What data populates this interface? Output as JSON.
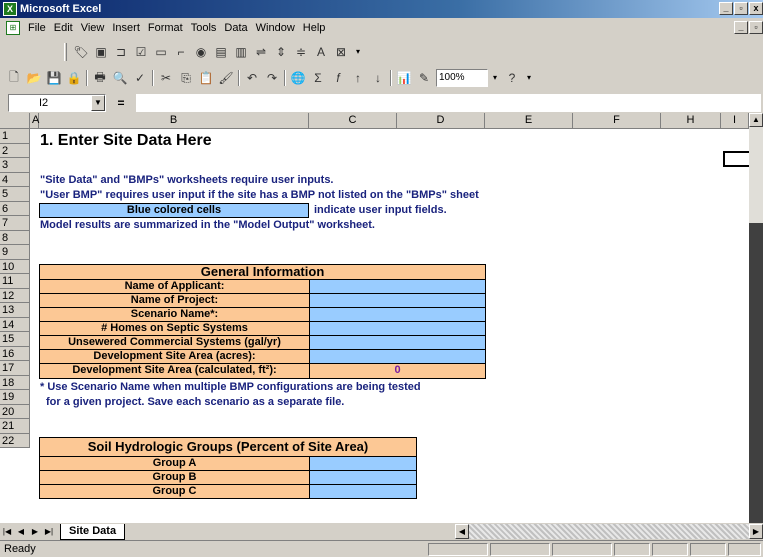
{
  "window": {
    "title": "Microsoft Excel",
    "app_icon": "excel-icon",
    "min_glyph": "_",
    "restore_glyph": "▫",
    "close_glyph": "x"
  },
  "menu": {
    "items": [
      "File",
      "Edit",
      "View",
      "Insert",
      "Format",
      "Tools",
      "Data",
      "Window",
      "Help"
    ],
    "doc_icon": "workbook-icon"
  },
  "toolbar": {
    "zoom": "100%"
  },
  "formula_bar": {
    "cell_ref": "I2",
    "equals": "=",
    "formula": ""
  },
  "columns": [
    "",
    "A",
    "B",
    "C",
    "D",
    "E",
    "F",
    "H",
    "I"
  ],
  "rows": [
    "1",
    "2",
    "3",
    "4",
    "5",
    "6",
    "7",
    "8",
    "9",
    "10",
    "11",
    "12",
    "13",
    "14",
    "15",
    "16",
    "17",
    "18",
    "19",
    "20",
    "21",
    "22"
  ],
  "sheet": {
    "heading": "1. Enter Site Data Here",
    "note_1": "\"Site Data\" and \"BMPs\" worksheets require user inputs.",
    "note_2": "\"User BMP\" requires user input if the site has a BMP not listed on the \"BMPs\" sheet",
    "legend_cell": "Blue colored cells",
    "legend_text": "indicate user input fields.",
    "note_3": "Model results are summarized in the \"Model Output\" worksheet.",
    "general": {
      "title": "General Information",
      "rows": [
        "Name of Applicant:",
        "Name of Project:",
        "Scenario Name*:",
        "# Homes on Septic Systems",
        "Unsewered Commercial Systems (gal/yr)",
        "Development Site Area (acres):",
        "Development Site Area (calculated, ft²):"
      ],
      "calculated_value": "0"
    },
    "footnote_1": "* Use Scenario Name when multiple BMP configurations are being tested",
    "footnote_2": "for a given project. Save each scenario as a separate file.",
    "soil": {
      "title": "Soil Hydrologic Groups (Percent of Site Area)",
      "rows": [
        "Group A",
        "Group B",
        "Group C"
      ]
    }
  },
  "tabs": {
    "active": "Site Data"
  },
  "status": {
    "text": "Ready"
  }
}
